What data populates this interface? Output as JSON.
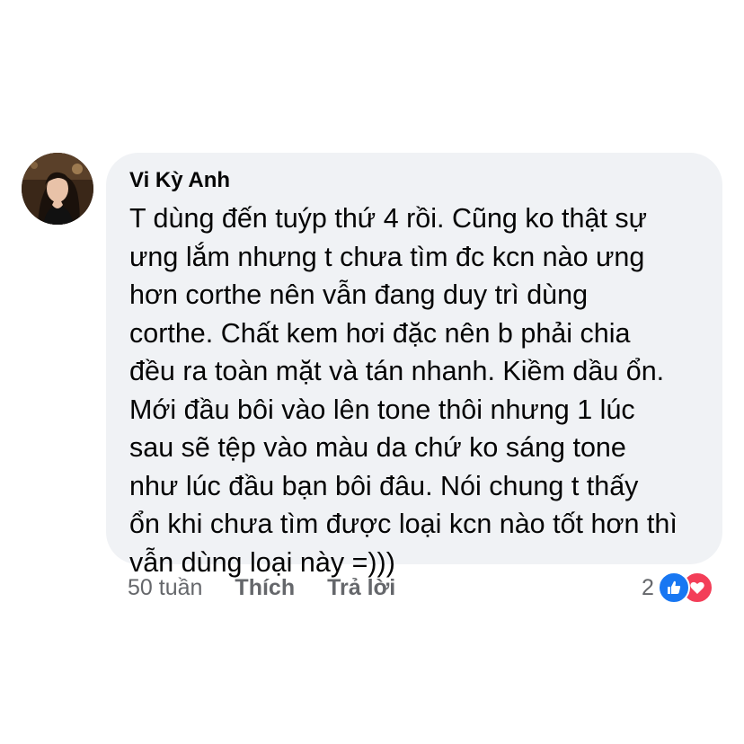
{
  "comment": {
    "author": "Vi Kỳ Anh",
    "text_lines": [
      "T dùng đến tuýp thứ 4 rồi. Cũng ko thật sự",
      "ưng lắm nhưng t chưa tìm đc kcn nào ưng",
      "hơn corthe nên vẫn đang duy trì dùng",
      "corthe. Chất kem hơi đặc nên b phải chia",
      "đều ra toàn mặt và tán nhanh. Kiềm dầu ổn.",
      "Mới đầu bôi vào lên tone thôi nhưng 1 lúc",
      "sau sẽ tệp vào màu da chứ ko sáng tone",
      "như lúc đầu bạn bôi đâu. Nói chung t thấy",
      "ổn khi chưa tìm được loại kcn nào tốt hơn thì",
      "vẫn dùng loại này =)))"
    ]
  },
  "actions": {
    "time": "50 tuần",
    "like_label": "Thích",
    "reply_label": "Trả lời"
  },
  "reactions": {
    "count": "2",
    "icons": [
      "like-icon",
      "love-icon"
    ],
    "colors": {
      "like": "#1877f2",
      "love": "#f33e58"
    }
  },
  "colors": {
    "bubble": "#f0f2f5",
    "text": "#050505",
    "secondary": "#65676b"
  }
}
